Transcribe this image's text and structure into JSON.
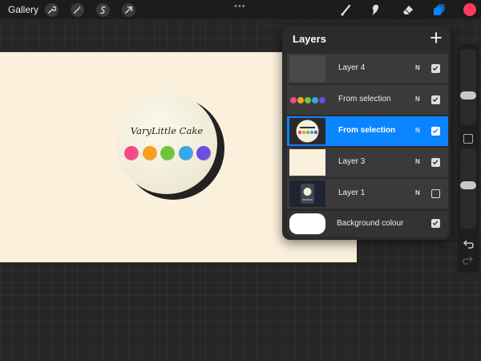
{
  "toolbar": {
    "gallery_label": "Gallery",
    "left_icons": [
      "wrench-icon",
      "magic-wand-icon",
      "selection-icon",
      "transform-arrow-icon"
    ],
    "more_dots": "•••",
    "right_tools": [
      "brush-icon",
      "smudge-icon",
      "eraser-icon",
      "layers-icon"
    ],
    "current_color": "#ff3b5c",
    "active_tool_color": "#0a84ff"
  },
  "canvas": {
    "background": "#fbf0dc",
    "logo_text": "VaryLittle Cake",
    "dot_colors": [
      "#f24b8a",
      "#f7a021",
      "#6fc43a",
      "#3aa5e8",
      "#6a4ee0"
    ]
  },
  "layers_panel": {
    "title": "Layers",
    "add_label": "+",
    "layers": [
      {
        "name": "Layer 4",
        "blend": "N",
        "visible": true,
        "selected": false
      },
      {
        "name": "From selection",
        "blend": "N",
        "visible": true,
        "selected": false
      },
      {
        "name": "From selection",
        "blend": "N",
        "visible": true,
        "selected": true
      },
      {
        "name": "Layer 3",
        "blend": "N",
        "visible": true,
        "selected": false
      },
      {
        "name": "Layer 1",
        "blend": "N",
        "visible": false,
        "selected": false
      }
    ],
    "background": {
      "name": "Background colour",
      "visible": true
    }
  },
  "sidebar": {
    "brush_size_level": 0.38,
    "opacity_level": 0.55
  }
}
